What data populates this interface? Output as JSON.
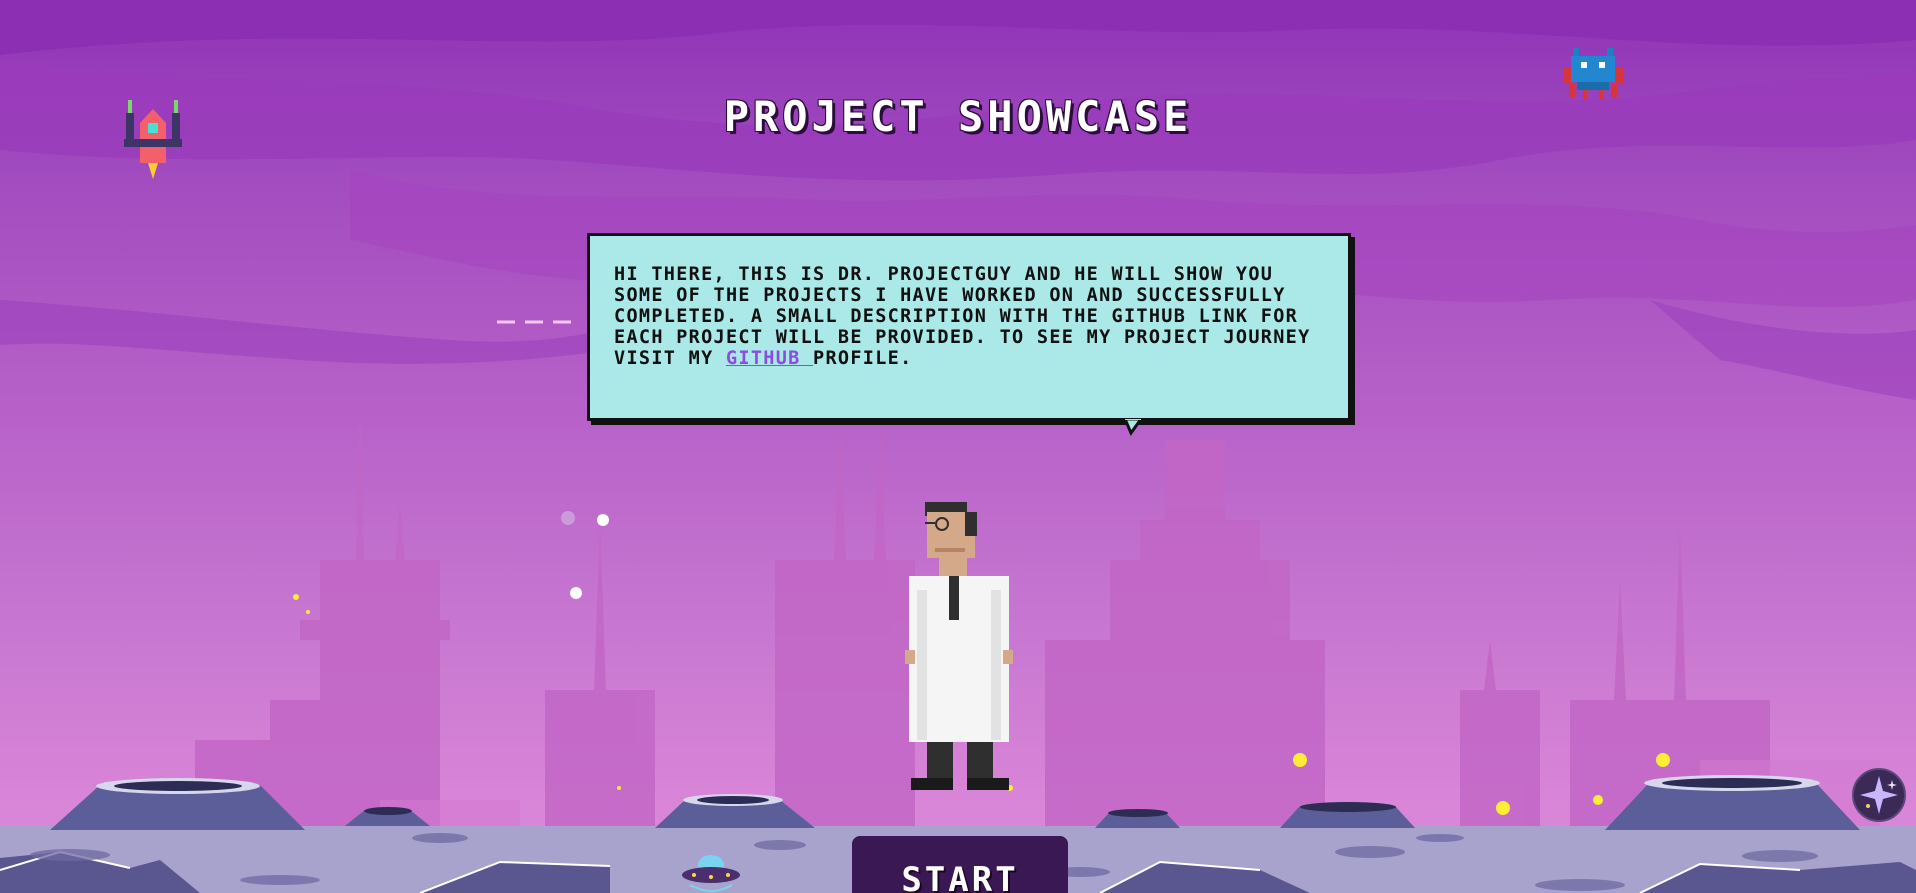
{
  "page": {
    "title": "PROJECT SHOWCASE"
  },
  "dialog": {
    "text_before_link": "HI THERE, THIS IS DR. PROJECTGUY AND HE WILL SHOW YOU SOME OF THE PROJECTS I HAVE WORKED ON AND SUCCESSFULLY COMPLETED. A SMALL DESCRIPTION WITH THE GITHUB LINK FOR EACH PROJECT WILL BE PROVIDED. TO SEE MY PROJECT JOURNEY VISIT MY ",
    "link_label": "GITHUB ",
    "text_after_link": "PROFILE."
  },
  "controls": {
    "start_label": "START"
  },
  "icons": {
    "rocket": "rocket-icon",
    "alien": "alien-invader-icon",
    "ufo": "ufo-icon",
    "sparkle": "sparkle-icon",
    "character": "scientist-character"
  },
  "colors": {
    "sky_top": "#8f33b6",
    "sky_bottom": "#d985d8",
    "bubble": "#abe8e8",
    "link": "#8a4de0",
    "start_button": "#3a1853",
    "ground": "#a7a3cc"
  }
}
